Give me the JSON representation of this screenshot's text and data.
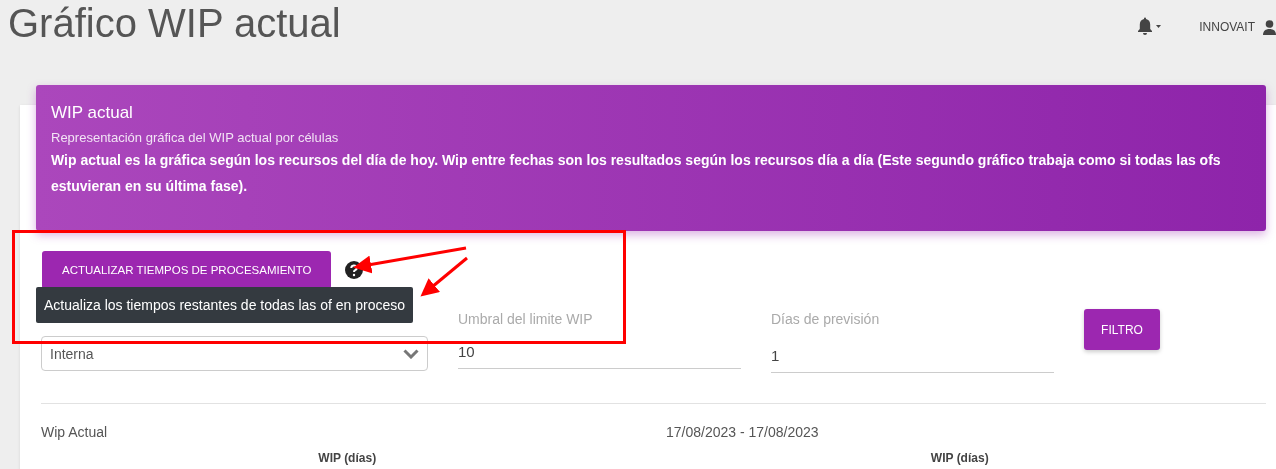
{
  "page_title": "Gráfico WIP actual",
  "user": {
    "name": "INNOVAIT"
  },
  "banner": {
    "title": "WIP actual",
    "subtitle": "Representación gráfica del WIP actual por células",
    "description": "Wip actual es la gráfica según los recursos del día de hoy. Wip entre fechas son los resultados según los recursos día a día (Este segundo gráfico trabaja como si todas las ofs estuvieran en su última fase)."
  },
  "action_button": "ACTUALIZAR TIEMPOS DE PROCESAMIENTO",
  "tooltip": "Actualiza los tiempos restantes de todas las of en proceso",
  "filters": [
    {
      "kind": "select",
      "value": "Interna"
    },
    {
      "kind": "text",
      "label": "Umbral del limite WIP",
      "value": "10"
    },
    {
      "kind": "text",
      "label": "Días de previsión",
      "value": "1"
    }
  ],
  "filter_button": "FILTRO",
  "section": {
    "title": "Wip Actual",
    "date_range": "17/08/2023 - 17/08/2023"
  },
  "charts": [
    {
      "title": "WIP (días)"
    },
    {
      "title": "WIP (días)"
    }
  ]
}
